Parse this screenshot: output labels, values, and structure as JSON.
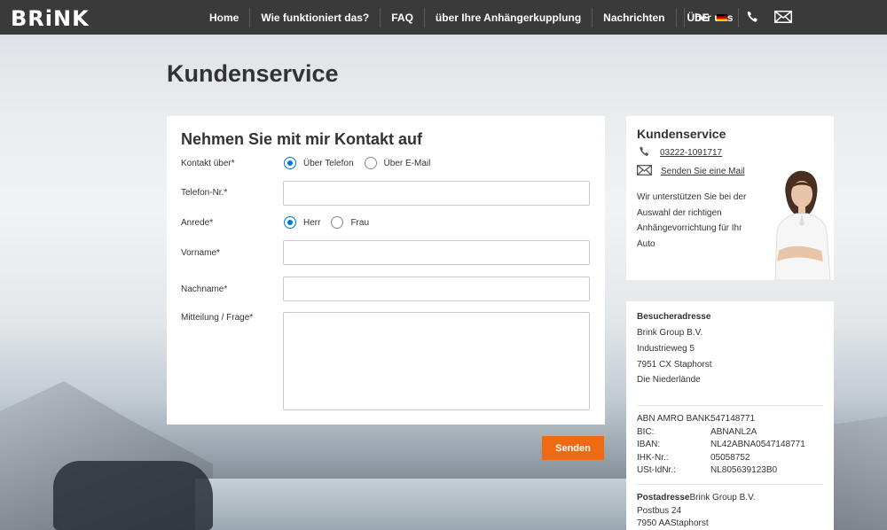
{
  "brand": "BRiNK",
  "nav": {
    "items": [
      "Home",
      "Wie funktioniert das?",
      "FAQ",
      "über Ihre Anhängerkupplung",
      "Nachrichten",
      "Über uns"
    ],
    "language": "DE",
    "phone_icon": "phone-icon",
    "mail_icon": "mail-icon"
  },
  "page_title": "Kundenservice",
  "form": {
    "heading": "Nehmen Sie mit mir Kontakt auf",
    "contact_via_label": "Kontakt über*",
    "contact_options": [
      "Über Telefon",
      "Über E-Mail"
    ],
    "contact_selected": "Über Telefon",
    "phone_label": "Telefon-Nr.*",
    "phone_value": "",
    "salutation_label": "Anrede*",
    "salutation_options": [
      "Herr",
      "Frau"
    ],
    "salutation_selected": "Herr",
    "firstname_label": "Vorname*",
    "firstname_value": "",
    "lastname_label": "Nachname*",
    "lastname_value": "",
    "message_label": "Mitteilung / Frage*",
    "message_value": "",
    "submit_label": "Senden"
  },
  "sidebar": {
    "title": "Kundenservice",
    "phone": "03222-1091717",
    "mail_link": "Senden Sie eine Mail",
    "text": "Wir unterstützen Sie bei der Auswahl der richtigen Anhängevorrichtung für Ihr Auto"
  },
  "address": {
    "visit_heading": "Besucheradresse",
    "visit_lines": [
      "Brink Group B.V.",
      "Industrieweg 5",
      "7951 CX Staphorst",
      "Die Niederlände"
    ],
    "bank": [
      {
        "k": "ABN AMRO BANK:",
        "v": "547148771"
      },
      {
        "k": "BIC:",
        "v": "ABNANL2A"
      },
      {
        "k": "IBAN:",
        "v": "NL42ABNA0547148771"
      },
      {
        "k": "IHK-Nr.:",
        "v": "05058752"
      },
      {
        "k": "USt-IdNr.:",
        "v": "NL805639123B0"
      }
    ],
    "post_heading": "Postadresse",
    "post_lines": [
      "Brink Group B.V.",
      "Postbus 24",
      "7950 AA",
      "Staphorst"
    ]
  },
  "colors": {
    "nav_bg": "#3a3a3a",
    "accent": "#f06a14",
    "radio": "#0078d7"
  }
}
